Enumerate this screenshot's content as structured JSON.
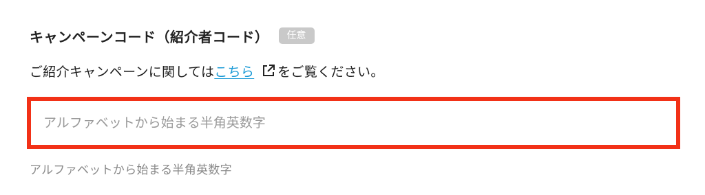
{
  "field": {
    "label": "キャンペーンコード（紹介者コード）",
    "badge": "任意"
  },
  "help": {
    "prefix": "ご紹介キャンペーンに関しては",
    "link_text": "こちら",
    "suffix": "をご覧ください。",
    "link_icon": "external-link-icon"
  },
  "input": {
    "value": "",
    "placeholder": "アルファベットから始まる半角英数字"
  },
  "hint": "アルファベットから始まる半角英数字",
  "colors": {
    "highlight_border": "#f23117",
    "link": "#1a9ad6",
    "badge_bg": "#c9c9c9"
  }
}
